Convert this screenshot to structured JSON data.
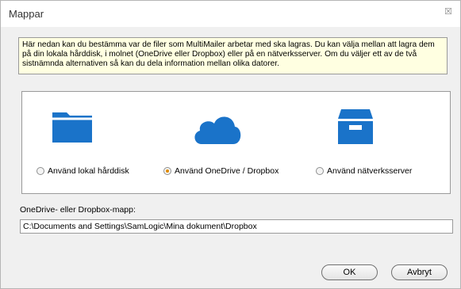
{
  "window": {
    "title": "Mappar",
    "close_glyph": "☒"
  },
  "info_text": "Här nedan kan du bestämma var de filer som MultiMailer arbetar med ska lagras. Du kan välja mellan att lagra dem på din lokala hårddisk, i molnet (OneDrive eller Dropbox) eller på en nätverksserver. Om du väljer ett av de två sistnämnda alternativen så kan du dela information mellan olika datorer.",
  "options": [
    {
      "label": "Använd lokal hårddisk",
      "icon": "folder-icon",
      "checked": false
    },
    {
      "label": "Använd OneDrive / Dropbox",
      "icon": "cloud-icon",
      "checked": true
    },
    {
      "label": "Använd nätverksserver",
      "icon": "inbox-tray-icon",
      "checked": false
    }
  ],
  "folder_label": "OneDrive- eller Dropbox-mapp:",
  "folder_path": "C:\\Documents and Settings\\SamLogic\\Mina dokument\\Dropbox",
  "buttons": {
    "ok": "OK",
    "cancel": "Avbryt"
  },
  "colors": {
    "accent": "#1a73c9",
    "info_bg": "#ffffe1",
    "radio_checked": "#e08a00"
  }
}
